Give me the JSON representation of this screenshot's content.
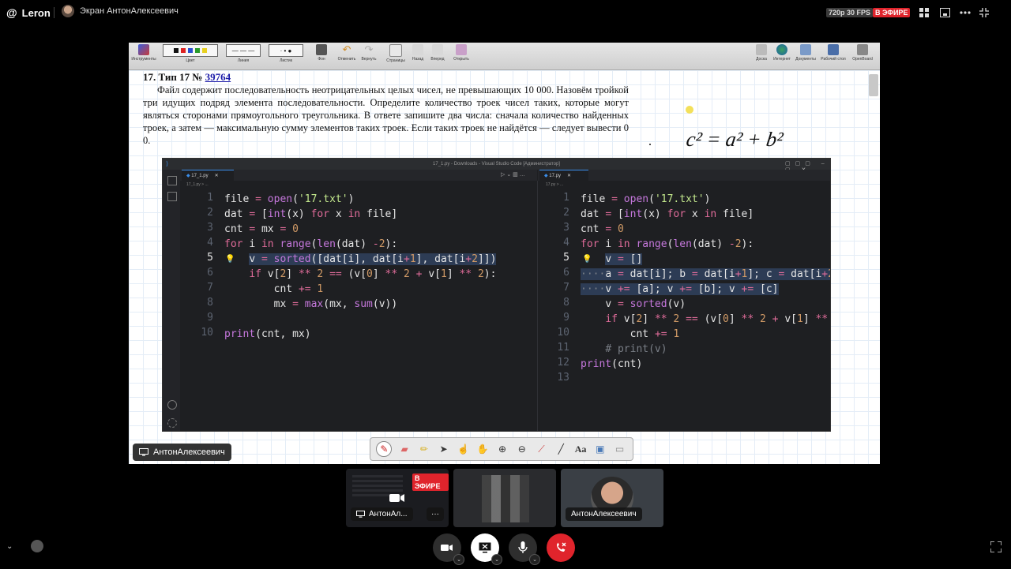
{
  "app": {
    "name": "Leron",
    "presenter_label": "Экран АнтонАлексеевич"
  },
  "stream": {
    "quality": "720p 30 FPS",
    "live_badge": "В ЭФИРЕ"
  },
  "whiteboard_toolbar": {
    "items": [
      "Инструменты",
      "Цвет",
      "Линия",
      "Листик",
      "Фон",
      "Отменить",
      "Вернуть",
      "Страницы",
      "Назад",
      "Вперед",
      "Открыть"
    ],
    "right_items": [
      "Доска",
      "Интернет",
      "Документы",
      "Рабочий стол",
      "OpenBoard"
    ]
  },
  "task": {
    "title_prefix": "17. Тип 17 №",
    "number": "39764",
    "text": "Файл содержит последовательность неотрицательных целых чисел, не превышающих 10 000. Назовём тройкой три идущих подряд элемента последовательности. Определите количество троек чисел таких, которые могут являться сторонами прямоугольного треугольника. В ответе запишите два числа: сначала количество найденных троек, а затем — максимальную сумму элементов таких троек. Если таких троек не найдётся — следует вывести 0 0."
  },
  "handwriting": "c² = a² + b²",
  "vscode": {
    "window_title": "17_1.py - Downloads - Visual Studio Code [Администратор]",
    "left_tab": "17_1.py",
    "left_crumb": "17_1.py > ...",
    "right_tab": "17.py",
    "right_crumb": "17.py > ..."
  },
  "presenter_chip": "АнтонАлексеевич",
  "thumbnails": {
    "first_live": "В ЭФИРЕ",
    "first_label": "АнтонАл...",
    "third_label": "АнтонАлексеевич"
  }
}
